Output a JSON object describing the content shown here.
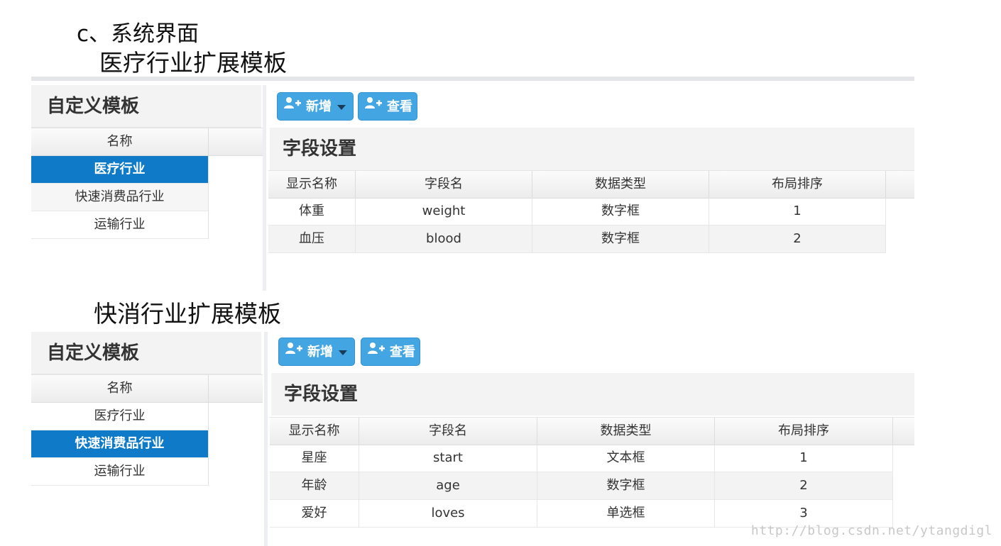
{
  "doc": {
    "heading": "c、系统界面",
    "sections": [
      {
        "title": "医疗行业扩展模板",
        "sidebar": {
          "header": "自定义模板",
          "column": "名称",
          "items": [
            "医疗行业",
            "快速消费品行业",
            "运输行业"
          ],
          "selected_index": 0
        },
        "toolbar": {
          "add_label": "新增",
          "view_label": "查看"
        },
        "panel_title": "字段设置",
        "table": {
          "columns": [
            "显示名称",
            "字段名",
            "数据类型",
            "布局排序"
          ],
          "rows": [
            [
              "体重",
              "weight",
              "数字框",
              "1"
            ],
            [
              "血压",
              "blood",
              "数字框",
              "2"
            ]
          ]
        }
      },
      {
        "title": "快消行业扩展模板",
        "sidebar": {
          "header": "自定义模板",
          "column": "名称",
          "items": [
            "医疗行业",
            "快速消费品行业",
            "运输行业"
          ],
          "selected_index": 1
        },
        "toolbar": {
          "add_label": "新增",
          "view_label": "查看"
        },
        "panel_title": "字段设置",
        "table": {
          "columns": [
            "显示名称",
            "字段名",
            "数据类型",
            "布局排序"
          ],
          "rows": [
            [
              "星座",
              "start",
              "文本框",
              "1"
            ],
            [
              "年龄",
              "age",
              "数字框",
              "2"
            ],
            [
              "爱好",
              "loves",
              "单选框",
              "3"
            ]
          ]
        }
      }
    ],
    "watermark": "http://blog.csdn.net/ytangdigl"
  },
  "colors": {
    "accent": "#0e7ac8",
    "button": "#43a6e2",
    "header_bg": "#f3f3f3"
  }
}
